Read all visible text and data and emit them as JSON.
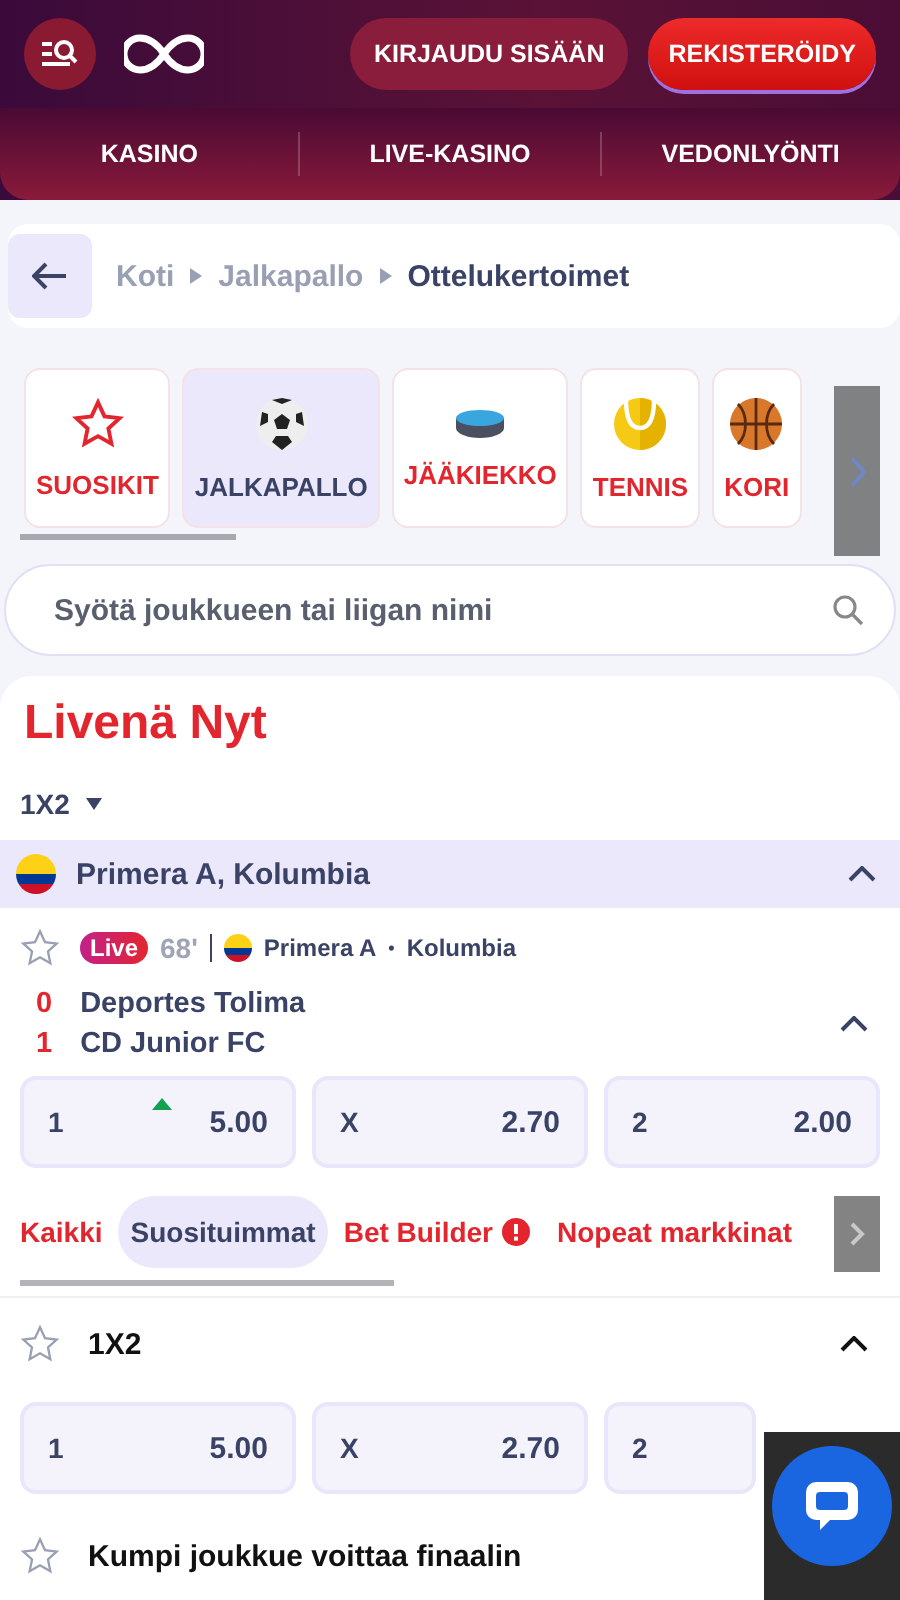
{
  "header": {
    "login_button": "KIRJAUDU SISÄÄN",
    "register_button": "REKISTERÖIDY"
  },
  "nav": [
    "KASINO",
    "LIVE-KASINO",
    "VEDONLYÖNTI"
  ],
  "breadcrumb": [
    {
      "label": "Koti",
      "current": false
    },
    {
      "label": "Jalkapallo",
      "current": false
    },
    {
      "label": "Ottelukertoimet",
      "current": true
    }
  ],
  "sports": [
    {
      "label": "SUOSIKIT",
      "kind": "star",
      "selected": false
    },
    {
      "label": "JALKAPALLO",
      "kind": "soccer",
      "selected": true
    },
    {
      "label": "JÄÄKIEKKO",
      "kind": "puck",
      "selected": false
    },
    {
      "label": "TENNIS",
      "kind": "tennis",
      "selected": false
    },
    {
      "label": "KORI",
      "kind": "basketball",
      "selected": false
    }
  ],
  "search": {
    "placeholder": "Syötä joukkueen tai liigan nimi"
  },
  "live": {
    "title": "Livenä Nyt",
    "market_select": "1X2",
    "league": {
      "name": "Primera A, Kolumbia",
      "expanded": true
    },
    "match": {
      "favorite": false,
      "badge": "Live",
      "minute": "68'",
      "league": "Primera A",
      "separator": "•",
      "country": "Kolumbia",
      "expanded": true,
      "teams": [
        {
          "score": "0",
          "name": "Deportes Tolima"
        },
        {
          "score": "1",
          "name": "CD Junior FC"
        }
      ],
      "odds": [
        {
          "label": "1",
          "value": "5.00",
          "rising": true
        },
        {
          "label": "X",
          "value": "2.70",
          "rising": false
        },
        {
          "label": "2",
          "value": "2.00",
          "rising": false
        }
      ]
    },
    "market_tabs": [
      {
        "label": "Kaikki",
        "selected": false,
        "info": false
      },
      {
        "label": "Suosituimmat",
        "selected": true,
        "info": false
      },
      {
        "label": "Bet Builder",
        "selected": false,
        "info": true
      },
      {
        "label": "Nopeat markkinat",
        "selected": false,
        "info": false
      }
    ],
    "markets": [
      {
        "title": "1X2",
        "favorite": false,
        "expanded": true,
        "odds": [
          {
            "label": "1",
            "value": "5.00"
          },
          {
            "label": "X",
            "value": "2.70"
          },
          {
            "label": "2"
          }
        ]
      },
      {
        "title": "Kumpi joukkue voittaa finaalin",
        "favorite": false
      }
    ]
  }
}
